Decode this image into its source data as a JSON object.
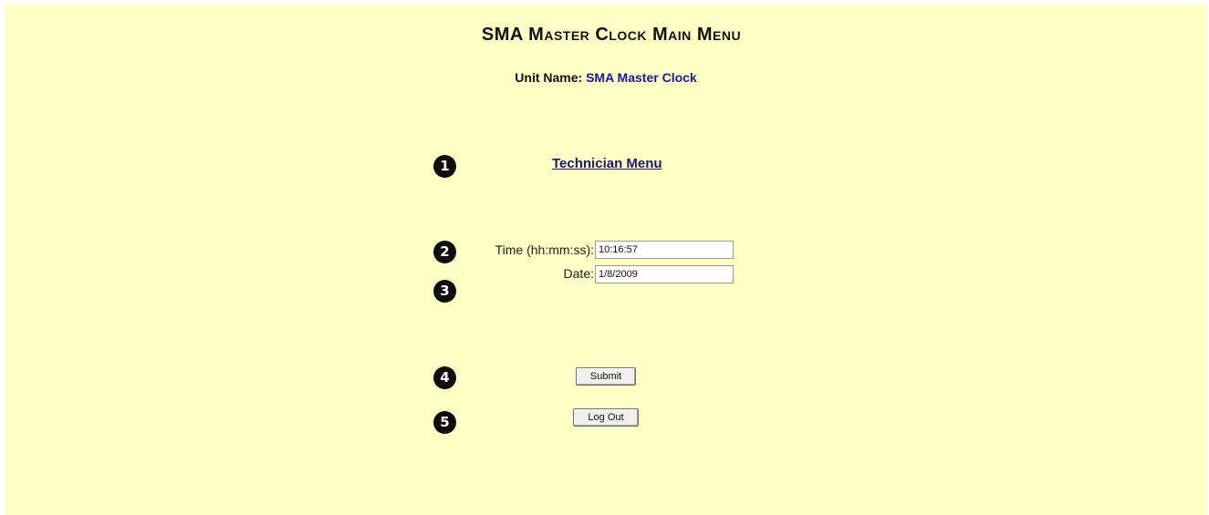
{
  "page": {
    "title": "SMA Master Clock Main Menu",
    "background_color": "#ffffc6"
  },
  "unit": {
    "label": "Unit Name:",
    "value": "SMA Master Clock"
  },
  "links": {
    "technician_menu": "Technician Menu"
  },
  "markers": [
    "1",
    "2",
    "3",
    "4",
    "5"
  ],
  "form": {
    "time_label": "Time (hh:mm:ss):",
    "time_value": "10:16:57",
    "date_label": "Date:",
    "date_value": "1/8/2009"
  },
  "buttons": {
    "submit": "Submit",
    "logout": "Log Out"
  }
}
